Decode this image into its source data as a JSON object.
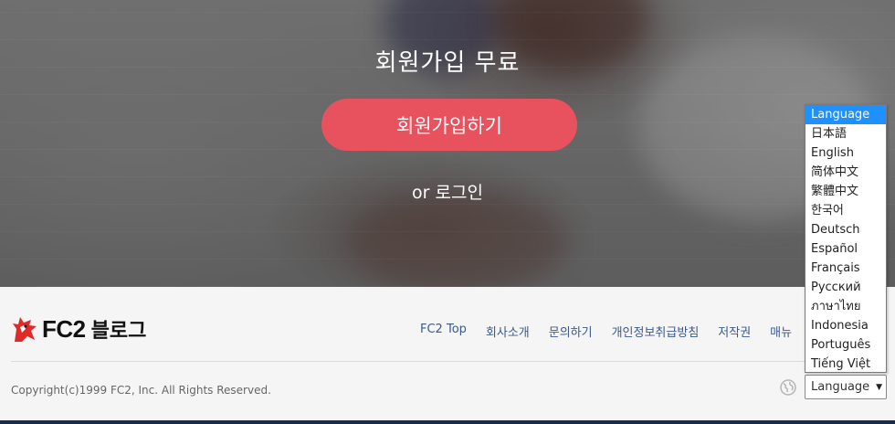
{
  "hero": {
    "title": "회원가입 무료",
    "signup_button": "회원가입하기",
    "login_link": "or 로그인"
  },
  "footer": {
    "logo_text": "FC2",
    "logo_sub": "블로그",
    "nav": [
      "FC2 Top",
      "회사소개",
      "문의하기",
      "개인정보취급방침",
      "저작권",
      "매뉴"
    ],
    "copyright": "Copyright(c)1999 FC2, Inc. All Rights Reserved."
  },
  "language": {
    "selected_label": "Language",
    "options": [
      "Language",
      "日本語",
      "English",
      "简体中文",
      "繁體中文",
      "한국어",
      "Deutsch",
      "Español",
      "Français",
      "Русский",
      "ภาษาไทย",
      "Indonesia",
      "Português",
      "Tiếng Việt"
    ],
    "highlighted_index": 0
  },
  "colors": {
    "signup_button": "#e8525e",
    "nav_link": "#3a5a8c",
    "dropdown_highlight": "#1e90ff"
  },
  "icons": {
    "globe": "globe-icon",
    "dropdown_arrow": "chevron-down-icon",
    "logo": "fc2-logo-icon"
  }
}
